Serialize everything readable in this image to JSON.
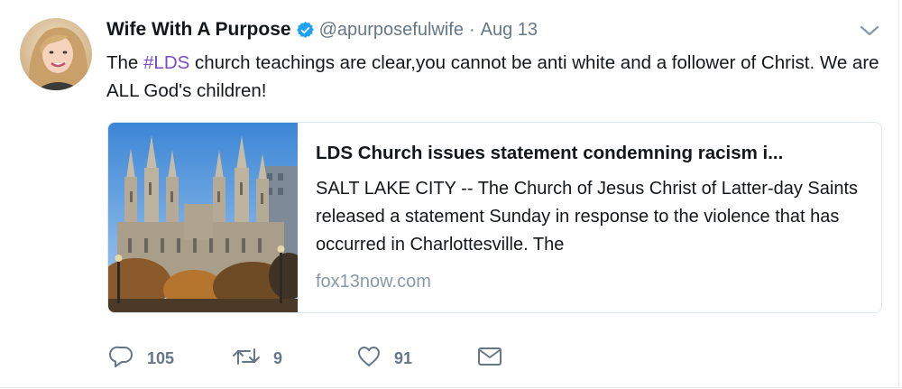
{
  "author": {
    "display_name": "Wife With A Purpose",
    "handle": "@apurposefulwife",
    "date_separator": "·",
    "date": "Aug 13",
    "verified_icon": "verified-badge-icon",
    "avatar_icon": "profile-photo"
  },
  "tweet": {
    "text_prefix": "The ",
    "hashtag": "#LDS",
    "text_suffix": " church teachings are clear,you cannot be anti white and a follower of Christ. We are ALL God's children!"
  },
  "card": {
    "title": "LDS Church issues statement condemning racism i...",
    "description": "SALT LAKE CITY -- The Church of Jesus Christ of Latter-day Saints released a statement Sunday in response to the violence that has occurred in Charlottesville. The",
    "domain": "fox13now.com",
    "image_icon": "temple-photo"
  },
  "actions": {
    "reply_count": "105",
    "retweet_count": "9",
    "like_count": "91"
  },
  "colors": {
    "hashtag": "#794bc4",
    "verified": "#1da1f2",
    "secondary_text": "#657786",
    "domain_text": "#8899a6"
  }
}
